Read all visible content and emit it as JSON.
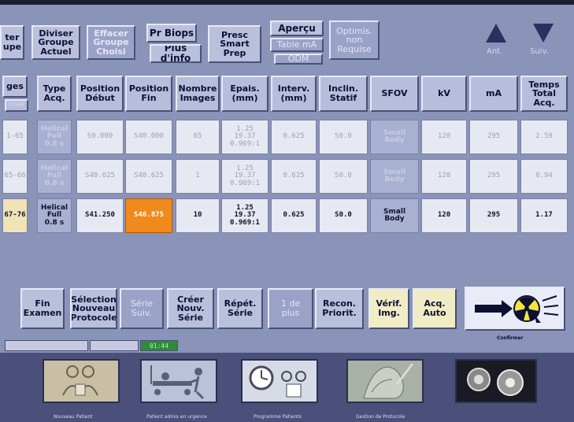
{
  "top_buttons": {
    "quitter_groupe": "ter\nupe",
    "diviser_groupe": "Diviser\nGroupe\nActuel",
    "effacer_groupe": "Effacer\nGroupe\nChoisi",
    "pr_biops": "Pr Biops",
    "plus_info": "Plus d'info",
    "presc_smart_prep": "Presc\nSmart\nPrep",
    "apercu": "Aperçu",
    "table_ma": "Table mA",
    "odm": "ODM",
    "optimis": "Optimis.\nnon\nRequise",
    "ant": "Ant.",
    "suiv": "Suiv."
  },
  "table": {
    "headers": [
      "ges",
      "Type\nAcq.",
      "Position\nDébut",
      "Position\nFin",
      "Nombre\nImages",
      "Epais.\n(mm)",
      "Interv.\n(mm)",
      "Inclin.\nStatif",
      "SFOV",
      "kV",
      "mA",
      "Temps\nTotal\nAcq."
    ],
    "header_sub": "viser",
    "rows": [
      [
        "1-65",
        "Helical\nFull\n0.8 s",
        "S0.000",
        "S40.000",
        "65",
        "1.25\n19.37\n0.969:1",
        "0.625",
        "S0.0",
        "Small\nBody",
        "120",
        "295",
        "2.59"
      ],
      [
        "65-66",
        "Helical\nFull\n0.8 s",
        "S40.625",
        "S40.625",
        "1",
        "1.25\n19.37\n0.969:1",
        "0.625",
        "S0.0",
        "Small\nBody",
        "120",
        "295",
        "0.94"
      ],
      [
        "67-76",
        "Helical\nFull\n0.8 s",
        "S41.250",
        "S46.875",
        "10",
        "1.25\n19.37\n0.969:1",
        "0.625",
        "S0.0",
        "Small\nBody",
        "120",
        "295",
        "1.17"
      ]
    ]
  },
  "bottom_buttons": {
    "fin_examen": "Fin\nExamen",
    "selection_protocole": "Sélection\nNouveau\nProtocole",
    "serie_suiv": "Série\nSuiv.",
    "creer_serie": "Créer\nNouv.\nSérie",
    "repet_serie": "Répét.\nSérie",
    "un_de_plus": "1 de\nplus",
    "recon_priorit": "Recon.\nPriorit.",
    "verif_img": "Vérif.\nImg.",
    "acq_auto": "Acq.\nAuto",
    "confirmer": "Confirmer"
  },
  "status": {
    "timer": "01:44"
  },
  "dock": [
    {
      "label": "Nouveau Patient",
      "icon": "new-patient-icon"
    },
    {
      "label": "Patient admis en urgence",
      "icon": "emergency-patient-icon"
    },
    {
      "label": "Programme Patients",
      "icon": "schedule-patients-icon"
    },
    {
      "label": "Gestion de Protocole",
      "icon": "protocol-management-icon"
    },
    {
      "label": "",
      "icon": "image-works-icon"
    }
  ],
  "colors": {
    "panel": "#8a93b8",
    "button": "#b9c0dc",
    "highlight_orange": "#f08a1c",
    "radiation_yellow": "#f2e43a",
    "timer_green": "#2f8a3a"
  }
}
